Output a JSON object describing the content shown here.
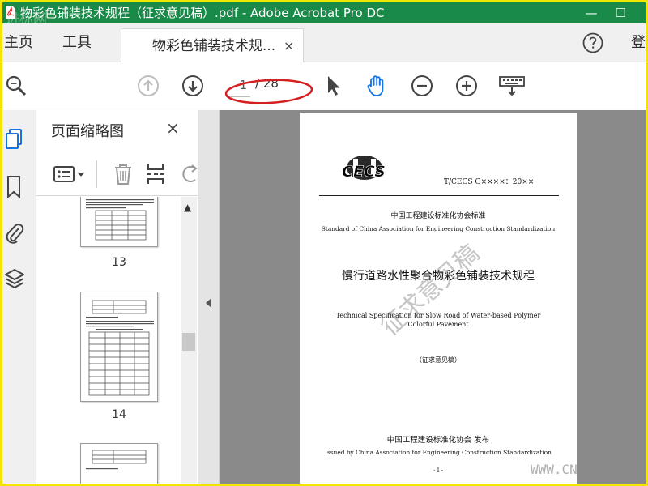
{
  "window": {
    "title": "物彩色铺装技术规程（征求意见稿）.pdf - Adobe Acrobat Pro DC",
    "minimize": "—",
    "maximize": "☐",
    "watermark": "进标网"
  },
  "tabs": {
    "home": "主页",
    "tools": "工具",
    "document": "物彩色铺装技术规...",
    "close": "×",
    "signin": "登"
  },
  "toolbar": {
    "current_page": "1",
    "total_pages": "/ 28"
  },
  "panel": {
    "title": "页面缩略图",
    "close": "×",
    "thumbnails": [
      {
        "number": "13"
      },
      {
        "number": "14"
      },
      {
        "number": ""
      }
    ]
  },
  "page": {
    "logo_text": "CECS",
    "standard_number": "T/CECS G××××：20××",
    "org_standard_cn": "中国工程建设标准化协会标准",
    "org_standard_en": "Standard of China Association for Engineering Construction Standardization",
    "title_cn": "慢行道路水性聚合物彩色铺装技术规程",
    "title_en": "Technical Specification for Slow Road of Water-based Polymer Colorful Pavement",
    "draft_label": "（征求意见稿）",
    "issuer_cn": "中国工程建设标准化协会  发布",
    "issuer_en": "Issued by China Association for Engineering Construction Standardization",
    "page_number": "- I -",
    "watermark": "征求意见稿"
  },
  "site_watermark": "WWW.CN",
  "icons": {
    "search": "search-icon",
    "prev_page": "arrow-up-circle-icon",
    "next_page": "arrow-down-circle-icon",
    "select": "cursor-icon",
    "hand": "hand-icon",
    "zoom_out": "zoom-out-icon",
    "zoom_in": "zoom-in-icon",
    "keyboard": "keyboard-icon",
    "help": "help-icon"
  },
  "colors": {
    "titlebar": "#1a8a48",
    "hand_tool": "#1473e6",
    "annotation_ellipse": "#d42020",
    "border": "#f2e600"
  }
}
